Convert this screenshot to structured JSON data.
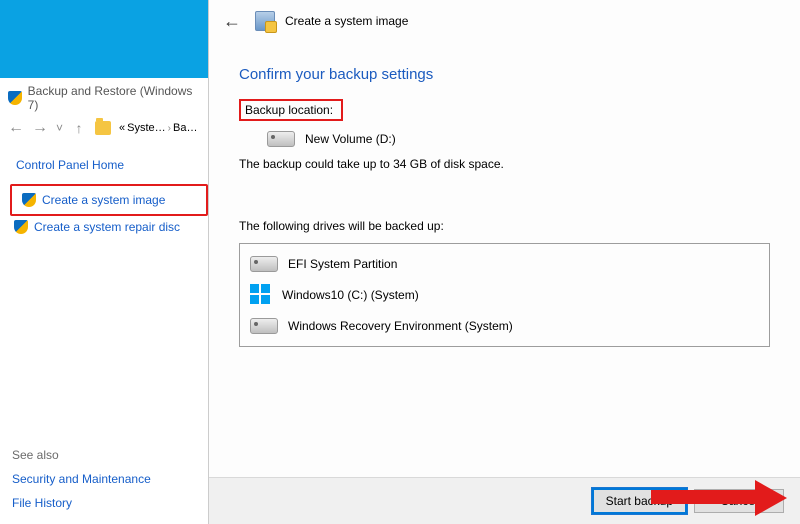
{
  "left": {
    "tab_title": "Backup and Restore (Windows 7)",
    "breadcrumb": {
      "seg1": "Syste…",
      "seg2": "Ba…",
      "prefix": "«"
    },
    "home": "Control Panel Home",
    "item_image": "Create a system image",
    "item_disc": "Create a system repair disc",
    "see_also": "See also",
    "link_security": "Security and Maintenance",
    "link_filehistory": "File History"
  },
  "dialog": {
    "title": "Create a system image",
    "heading": "Confirm your backup settings",
    "backup_location_label": "Backup location:",
    "backup_target": "New Volume (D:)",
    "size_note": "The backup could take up to 34 GB of disk space.",
    "list_label": "The following drives will be backed up:",
    "drives": [
      "EFI System Partition",
      "Windows10 (C:) (System)",
      "Windows Recovery Environment (System)"
    ],
    "start": "Start backup",
    "cancel": "Cancel"
  }
}
